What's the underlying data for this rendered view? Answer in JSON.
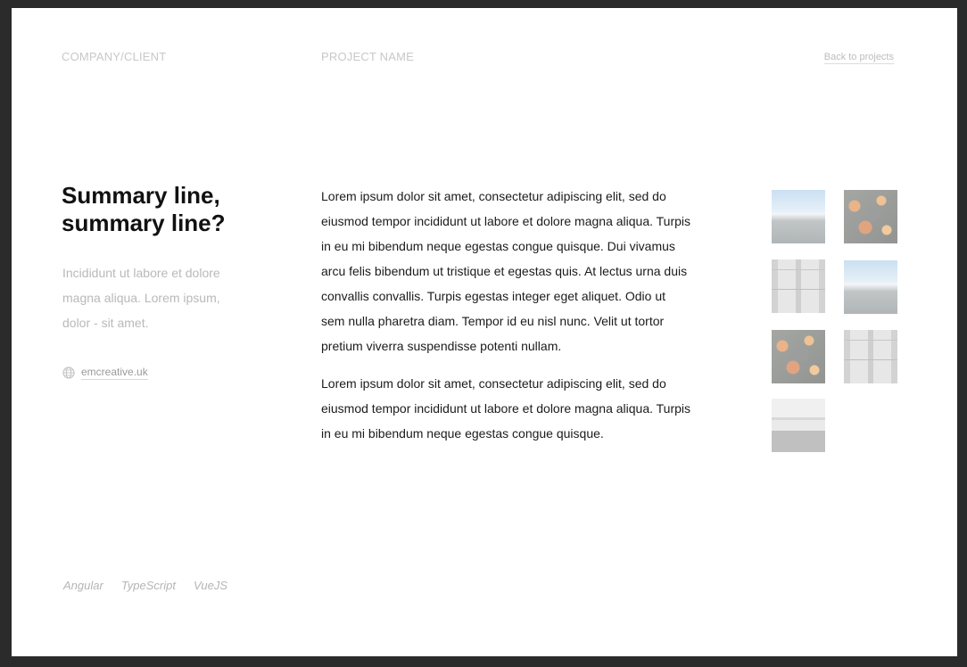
{
  "header": {
    "company": "COMPANY/CLIENT",
    "project": "PROJECT NAME",
    "back_link": "Back to projects"
  },
  "summary": {
    "title": "Summary line, summary line?",
    "text": "Incididunt ut labore et dolore magna aliqua. Lorem ipsum, dolor - sit amet.",
    "website_icon": "globe-icon",
    "website": "emcreative.uk"
  },
  "body": {
    "paragraphs": [
      "Lorem ipsum dolor sit amet, consectetur adipiscing elit, sed do eiusmod tempor incididunt ut labore et dolore magna aliqua. Turpis in eu mi bibendum neque egestas congue quisque. Dui vivamus arcu felis bibendum ut tristique et egestas quis. At lectus urna duis convallis convallis. Turpis egestas integer eget aliquet. Odio ut sem nulla pharetra diam. Tempor id eu nisl nunc. Velit ut tortor pretium viverra suspendisse potenti nullam.",
      "Lorem ipsum dolor sit amet, consectetur adipiscing elit, sed do eiusmod tempor incididunt ut labore et dolore magna aliqua. Turpis in eu mi bibendum neque egestas congue quisque."
    ]
  },
  "gallery": {
    "images": [
      "mountain",
      "autumn",
      "building",
      "mountain",
      "autumn",
      "building",
      "pier"
    ]
  },
  "tags": [
    "Angular",
    "TypeScript",
    "VueJS"
  ],
  "colors": {
    "background": "#2b2b2b",
    "card": "#ffffff",
    "muted_text": "#c8c8c8",
    "body_text": "#1b1b1b"
  }
}
